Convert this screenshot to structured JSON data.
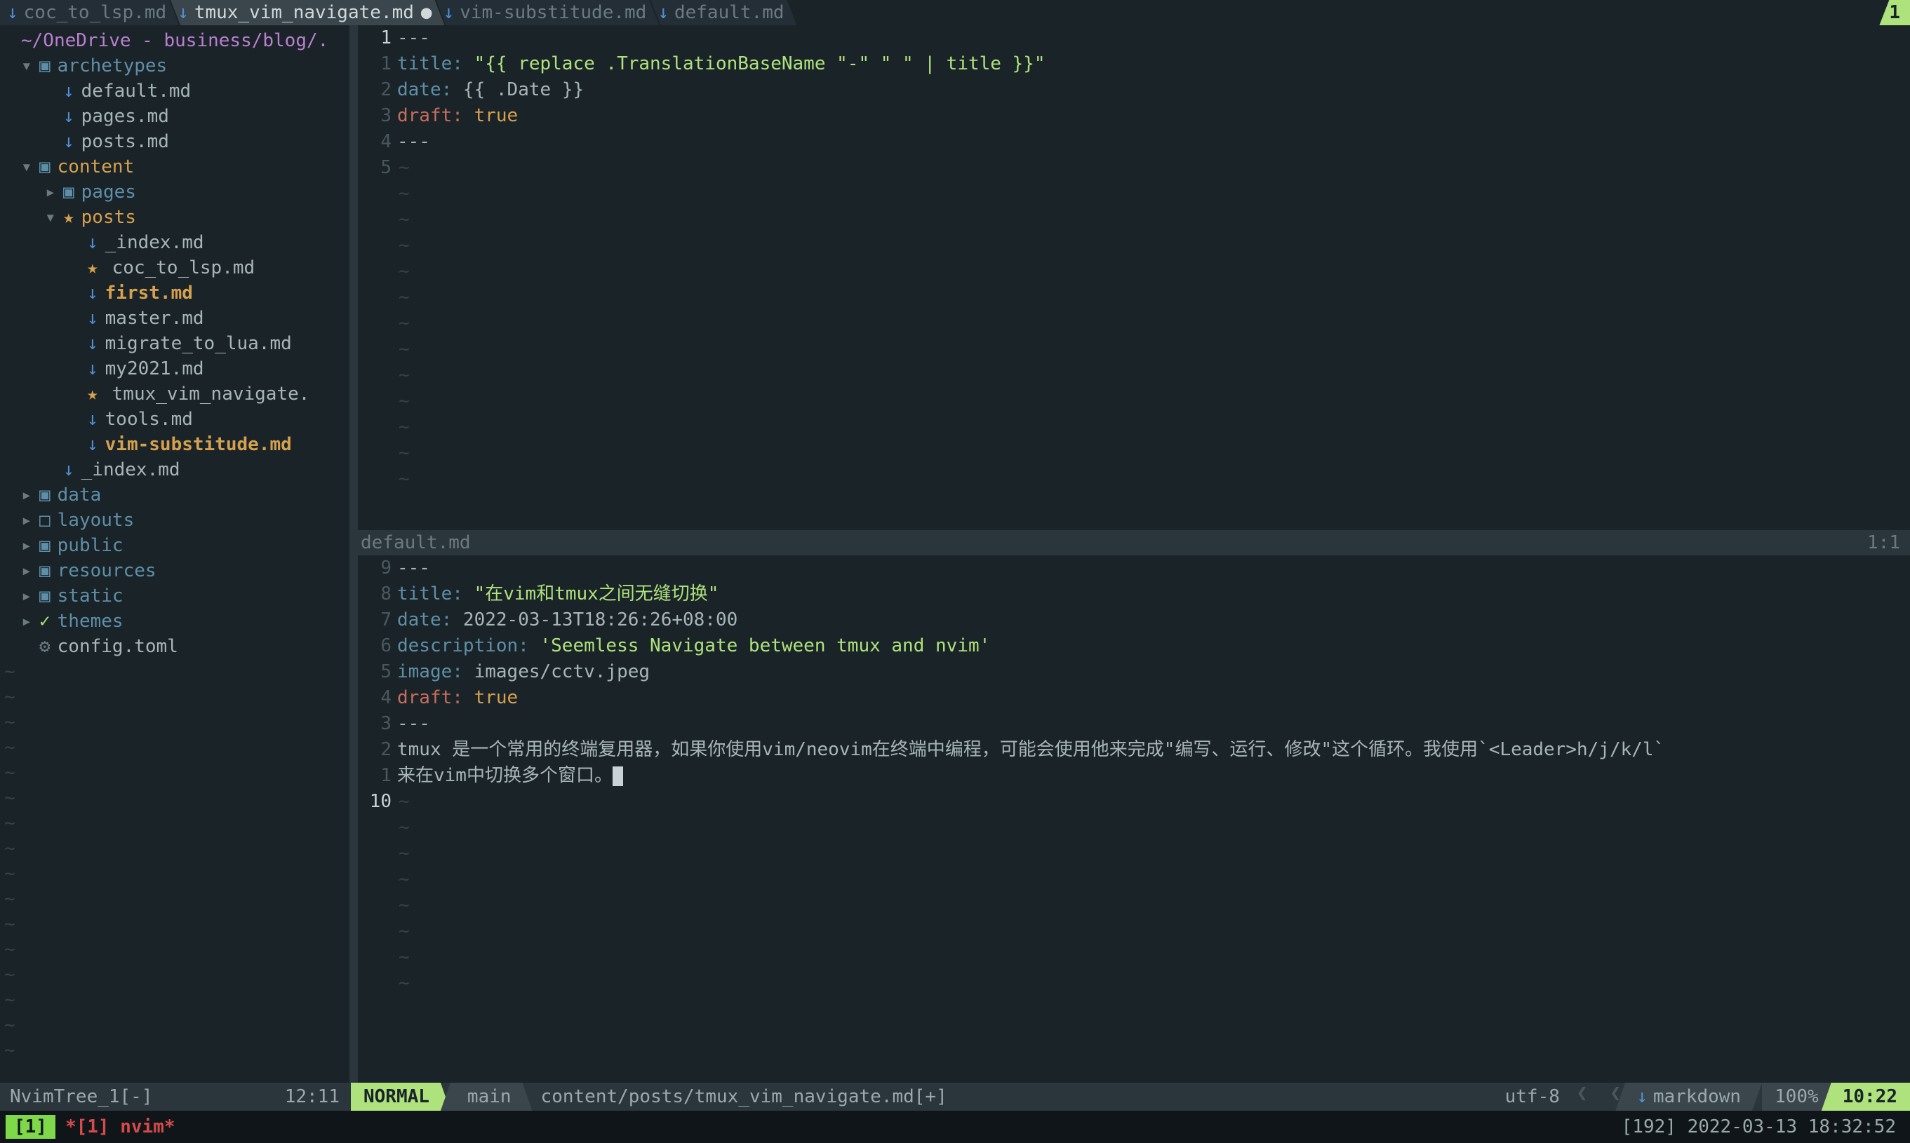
{
  "tabs": [
    {
      "label": "coc_to_lsp.md",
      "icon": "↓",
      "active": false,
      "modified": false
    },
    {
      "label": "tmux_vim_navigate.md",
      "icon": "↓",
      "active": true,
      "modified": true
    },
    {
      "label": "vim-substitude.md",
      "icon": "↓",
      "active": false,
      "modified": false
    },
    {
      "label": "default.md",
      "icon": "↓",
      "active": false,
      "modified": false
    }
  ],
  "tab_right": "1",
  "tree": {
    "root": "~/OneDrive - business/blog/.",
    "items": [
      {
        "depth": 0,
        "arrow": "▾",
        "icon": "folder-open",
        "name": "archetypes",
        "type": "folder"
      },
      {
        "depth": 1,
        "arrow": "",
        "icon": "md",
        "name": "default.md",
        "type": "file"
      },
      {
        "depth": 1,
        "arrow": "",
        "icon": "md",
        "name": "pages.md",
        "type": "file"
      },
      {
        "depth": 1,
        "arrow": "",
        "icon": "md",
        "name": "posts.md",
        "type": "file"
      },
      {
        "depth": 0,
        "arrow": "▾",
        "icon": "folder-open",
        "name": "content",
        "type": "folder",
        "orange": true
      },
      {
        "depth": 1,
        "arrow": "▸",
        "icon": "folder-closed",
        "name": "pages",
        "type": "folder"
      },
      {
        "depth": 1,
        "arrow": "▾",
        "icon": "star",
        "name": "posts",
        "type": "folder",
        "orange": true
      },
      {
        "depth": 2,
        "arrow": "",
        "icon": "md",
        "name": "_index.md",
        "type": "file"
      },
      {
        "depth": 2,
        "arrow": "",
        "icon": "star-md",
        "name": "coc_to_lsp.md",
        "type": "file"
      },
      {
        "depth": 2,
        "arrow": "",
        "icon": "md",
        "name": "first.md",
        "type": "file",
        "bold": true,
        "orange": true
      },
      {
        "depth": 2,
        "arrow": "",
        "icon": "md",
        "name": "master.md",
        "type": "file"
      },
      {
        "depth": 2,
        "arrow": "",
        "icon": "md",
        "name": "migrate_to_lua.md",
        "type": "file"
      },
      {
        "depth": 2,
        "arrow": "",
        "icon": "md",
        "name": "my2021.md",
        "type": "file"
      },
      {
        "depth": 2,
        "arrow": "",
        "icon": "star-md",
        "name": "tmux_vim_navigate.",
        "type": "file"
      },
      {
        "depth": 2,
        "arrow": "",
        "icon": "md",
        "name": "tools.md",
        "type": "file"
      },
      {
        "depth": 2,
        "arrow": "",
        "icon": "md",
        "name": "vim-substitude.md",
        "type": "file",
        "bold": true,
        "orange": true
      },
      {
        "depth": 1,
        "arrow": "",
        "icon": "md",
        "name": "_index.md",
        "type": "file"
      },
      {
        "depth": 0,
        "arrow": "▸",
        "icon": "folder-closed",
        "name": "data",
        "type": "folder"
      },
      {
        "depth": 0,
        "arrow": "▸",
        "icon": "folder-closed-empty",
        "name": "layouts",
        "type": "folder"
      },
      {
        "depth": 0,
        "arrow": "▸",
        "icon": "folder-closed",
        "name": "public",
        "type": "folder"
      },
      {
        "depth": 0,
        "arrow": "▸",
        "icon": "folder-closed",
        "name": "resources",
        "type": "folder"
      },
      {
        "depth": 0,
        "arrow": "▸",
        "icon": "folder-closed",
        "name": "static",
        "type": "folder"
      },
      {
        "depth": 0,
        "arrow": "▸",
        "icon": "check",
        "name": "themes",
        "type": "folder"
      },
      {
        "depth": 0,
        "arrow": "",
        "icon": "gear",
        "name": "config.toml",
        "type": "file"
      }
    ]
  },
  "linenos_top": [
    "1",
    "1",
    "2",
    "3",
    "4",
    "5"
  ],
  "editor_top": [
    {
      "t": "---"
    },
    {
      "segs": [
        [
          "kw",
          "title:"
        ],
        [
          "",
          " "
        ],
        [
          "str",
          "\"{{ replace .TranslationBaseName \"-\" \" \" | title }}\""
        ]
      ]
    },
    {
      "segs": [
        [
          "kw",
          "date:"
        ],
        [
          "",
          " {{ .Date }}"
        ]
      ]
    },
    {
      "segs": [
        [
          "draft",
          "draft:"
        ],
        [
          "",
          " "
        ],
        [
          "bool",
          "true"
        ]
      ]
    },
    {
      "t": "---"
    },
    {
      "t": ""
    }
  ],
  "winbar_inactive": {
    "left": "default.md",
    "right": "1:1"
  },
  "linenos_bottom": [
    "9",
    "8",
    "7",
    "6",
    "5",
    "4",
    "3",
    "2",
    "1",
    "10"
  ],
  "editor_bottom": [
    {
      "t": "---"
    },
    {
      "segs": [
        [
          "kw",
          "title:"
        ],
        [
          "",
          " "
        ],
        [
          "str",
          "\"在vim和tmux之间无缝切换\""
        ]
      ]
    },
    {
      "segs": [
        [
          "kw",
          "date:"
        ],
        [
          "",
          " 2022-03-13T18:26:26+08:00"
        ]
      ]
    },
    {
      "segs": [
        [
          "kw",
          "description:"
        ],
        [
          "",
          " "
        ],
        [
          "str",
          "'Seemless Navigate between tmux and nvim'"
        ]
      ]
    },
    {
      "segs": [
        [
          "kw",
          "image:"
        ],
        [
          "",
          " images/cctv.jpeg"
        ]
      ]
    },
    {
      "segs": [
        [
          "draft",
          "draft:"
        ],
        [
          "",
          " "
        ],
        [
          "bool",
          "true"
        ]
      ]
    },
    {
      "t": "---"
    },
    {
      "t": ""
    },
    {
      "t": "tmux 是一个常用的终端复用器，如果你使用vim/neovim在终端中编程，可能会使用他来完成\"编写、运行、修改\"这个循环。我使用`<Leader>h/j/k/l`"
    },
    {
      "t_cursor": "来在vim中切换多个窗口。"
    }
  ],
  "sidebar_status": {
    "left": "NvimTree_1[-]",
    "right": "12:11"
  },
  "statusline": {
    "mode": "NORMAL",
    "branch_icon": "",
    "branch": "main",
    "path": "content/posts/tmux_vim_navigate.md[+]",
    "encoding": "utf-8",
    "os_icon": "",
    "filetype": "markdown",
    "percent": "100%",
    "position": "10:22"
  },
  "tmux": {
    "session": "[1]",
    "window": "*[1] nvim*",
    "right": "[192] 2022-03-13 18:32:52"
  }
}
